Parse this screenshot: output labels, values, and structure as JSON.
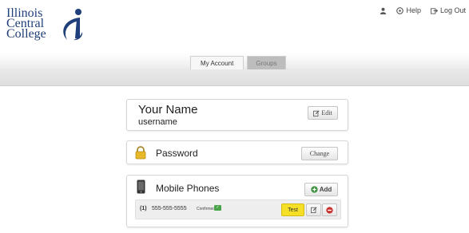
{
  "logo": {
    "line1": "Illinois",
    "line2": "Central",
    "line3": "College"
  },
  "top_links": {
    "help": "Help",
    "logout": "Log Out"
  },
  "tabs": [
    {
      "label": "My Account",
      "active": true
    },
    {
      "label": "Groups",
      "active": false
    }
  ],
  "profile": {
    "name": "Your Name",
    "username": "username",
    "edit_label": "Edit"
  },
  "password": {
    "label": "Password",
    "change_label": "Change"
  },
  "phones": {
    "label": "Mobile Phones",
    "add_label": "Add",
    "items": [
      {
        "index": "(1)",
        "number": "555-555-5555",
        "status": "Confirmed",
        "test_label": "Test"
      }
    ]
  },
  "colors": {
    "brand_blue": "#1f3f7a",
    "test_yellow": "#f6e027",
    "confirmed_green": "#4aa54a",
    "add_green": "#3a8f3a",
    "delete_red": "#c9302c"
  }
}
